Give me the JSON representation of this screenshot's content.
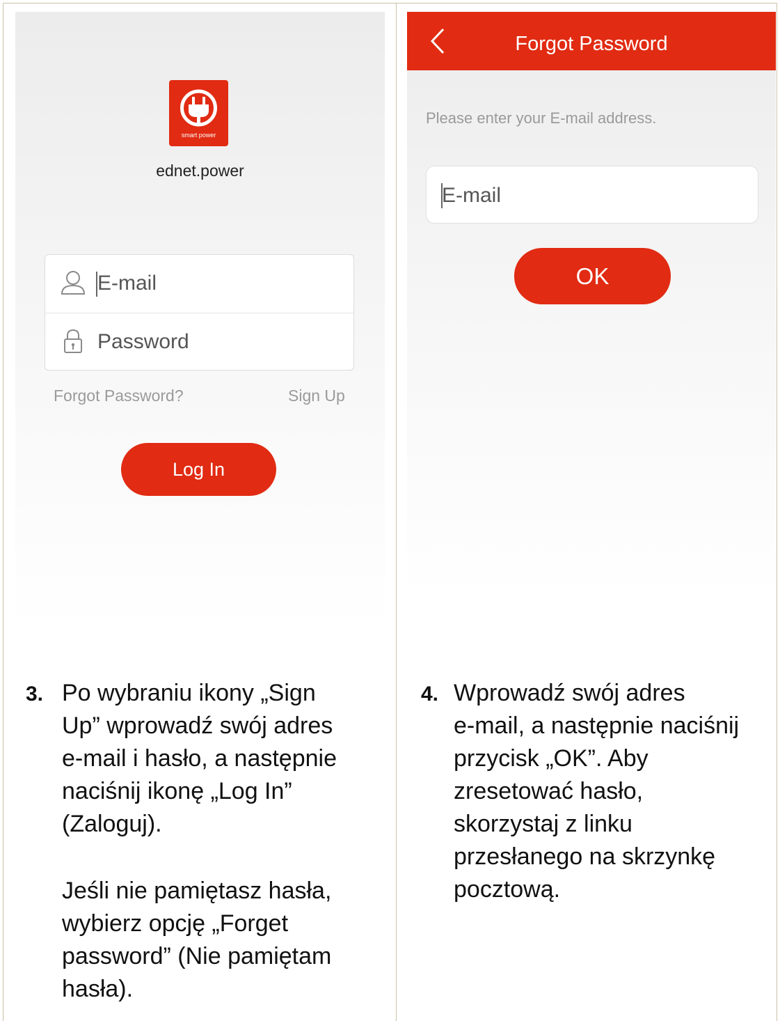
{
  "left_screen": {
    "logo_caption": "smart power",
    "app_name": "ednet.power",
    "email_placeholder": "E-mail",
    "password_placeholder": "Password",
    "forgot_link": "Forgot Password?",
    "signup_link": "Sign Up",
    "login_button": "Log In"
  },
  "right_screen": {
    "header_title": "Forgot Password",
    "prompt": "Please enter your E-mail address.",
    "email_placeholder": "E-mail",
    "ok_button": "OK"
  },
  "steps": [
    {
      "number": "3.",
      "text": "Po wybraniu ikony „Sign\nUp” wprowadź swój adres\ne-mail i hasło, a następnie\nnaciśnij ikonę „Log In”\n(Zaloguj).",
      "text2": "Jeśli nie pamiętasz hasła,\nwybierz opcję „Forget\npassword” (Nie pamiętam\nhasła)."
    },
    {
      "number": "4.",
      "text": "Wprowadź swój adres\ne-mail, a następnie naciśnij\nprzycisk „OK”. Aby\nzresetować hasło,\nskorzystaj z linku\nprzesłanego na skrzynkę\npocztową."
    }
  ],
  "colors": {
    "accent": "#e12b12",
    "border": "#c9c2a6",
    "link_gray": "#9a9a9a"
  },
  "icons": [
    "power-plug-icon",
    "user-icon",
    "lock-icon",
    "back-arrow-icon"
  ]
}
